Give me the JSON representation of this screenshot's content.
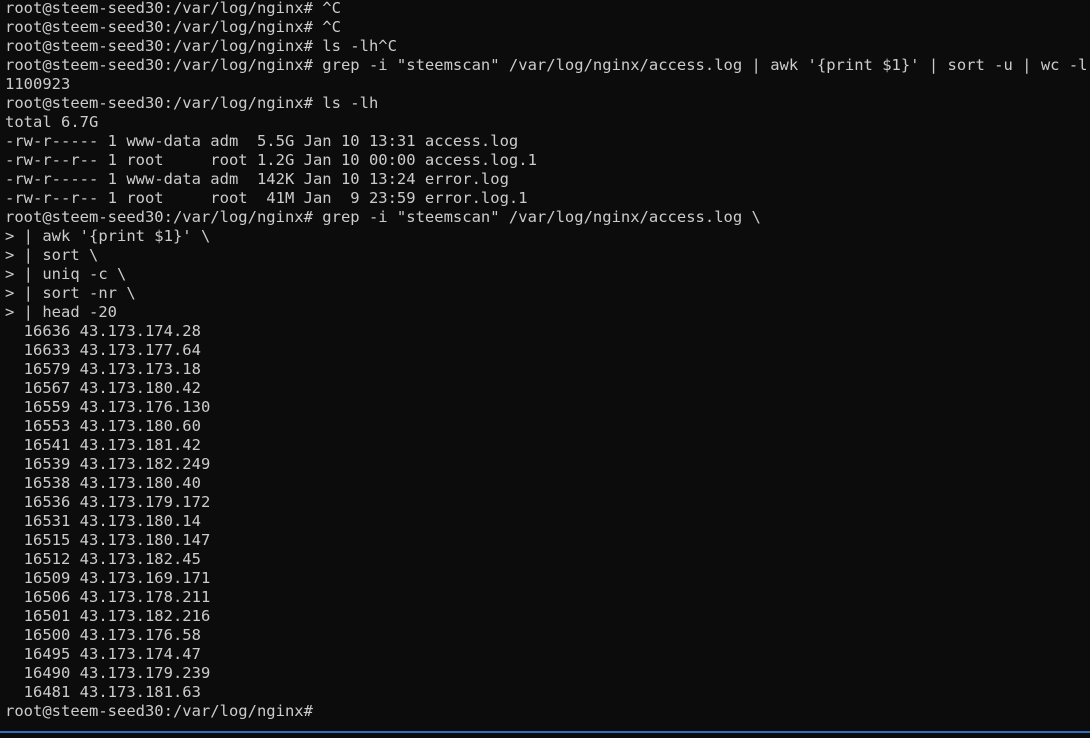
{
  "terminal": {
    "lines": [
      "root@steem-seed30:/var/log/nginx# ^C",
      "root@steem-seed30:/var/log/nginx# ^C",
      "root@steem-seed30:/var/log/nginx# ls -lh^C",
      "root@steem-seed30:/var/log/nginx# grep -i \"steemscan\" /var/log/nginx/access.log | awk '{print $1}' | sort -u | wc -l",
      "1100923",
      "root@steem-seed30:/var/log/nginx# ls -lh",
      "total 6.7G",
      "-rw-r----- 1 www-data adm  5.5G Jan 10 13:31 access.log",
      "-rw-r--r-- 1 root     root 1.2G Jan 10 00:00 access.log.1",
      "-rw-r----- 1 www-data adm  142K Jan 10 13:24 error.log",
      "-rw-r--r-- 1 root     root  41M Jan  9 23:59 error.log.1",
      "root@steem-seed30:/var/log/nginx# grep -i \"steemscan\" /var/log/nginx/access.log \\",
      "> | awk '{print $1}' \\",
      "> | sort \\",
      "> | uniq -c \\",
      "> | sort -nr \\",
      "> | head -20",
      "  16636 43.173.174.28",
      "  16633 43.173.177.64",
      "  16579 43.173.173.18",
      "  16567 43.173.180.42",
      "  16559 43.173.176.130",
      "  16553 43.173.180.60",
      "  16541 43.173.181.42",
      "  16539 43.173.182.249",
      "  16538 43.173.180.40",
      "  16536 43.173.179.172",
      "  16531 43.173.180.14",
      "  16515 43.173.180.147",
      "  16512 43.173.182.45",
      "  16509 43.173.169.171",
      "  16506 43.173.178.211",
      "  16501 43.173.182.216",
      "  16500 43.173.176.58",
      "  16495 43.173.174.47",
      "  16490 43.173.179.239",
      "  16481 43.173.181.63"
    ],
    "prompt": "root@steem-seed30:/var/log/nginx# "
  },
  "colors": {
    "background": "#0c0c0c",
    "text": "#cccccc",
    "accent": "#2f6fbf"
  }
}
